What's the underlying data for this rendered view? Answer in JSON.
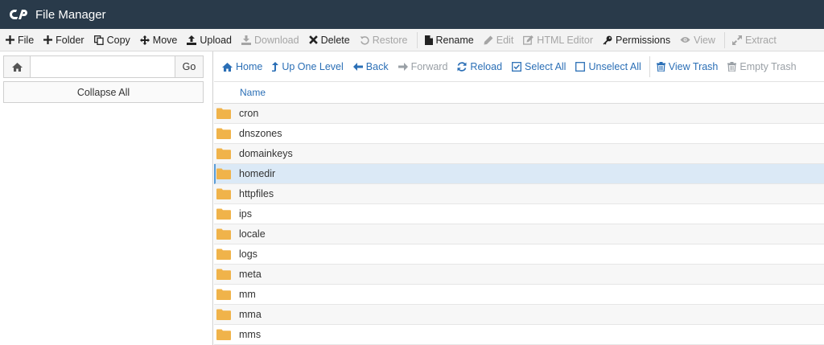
{
  "app": {
    "title": "File Manager"
  },
  "toolbar": [
    {
      "label": "File",
      "icon": "plus-icon",
      "disabled": false
    },
    {
      "label": "Folder",
      "icon": "plus-icon",
      "disabled": false
    },
    {
      "label": "Copy",
      "icon": "copy-icon",
      "disabled": false
    },
    {
      "label": "Move",
      "icon": "move-icon",
      "disabled": false
    },
    {
      "label": "Upload",
      "icon": "upload-icon",
      "disabled": false
    },
    {
      "label": "Download",
      "icon": "download-icon",
      "disabled": true
    },
    {
      "label": "Delete",
      "icon": "delete-icon",
      "disabled": false
    },
    {
      "label": "Restore",
      "icon": "restore-icon",
      "disabled": true
    },
    {
      "label": "Rename",
      "icon": "rename-icon",
      "disabled": false
    },
    {
      "label": "Edit",
      "icon": "pencil-icon",
      "disabled": true
    },
    {
      "label": "HTML Editor",
      "icon": "html-editor-icon",
      "disabled": true
    },
    {
      "label": "Permissions",
      "icon": "key-icon",
      "disabled": false
    },
    {
      "label": "View",
      "icon": "eye-icon",
      "disabled": true
    },
    {
      "label": "Extract",
      "icon": "extract-icon",
      "disabled": true
    }
  ],
  "leftpanel": {
    "path_value": "",
    "go_label": "Go",
    "collapse_label": "Collapse All"
  },
  "navbar": [
    {
      "label": "Home",
      "icon": "home-icon",
      "disabled": false
    },
    {
      "label": "Up One Level",
      "icon": "up-level-icon",
      "disabled": false
    },
    {
      "label": "Back",
      "icon": "back-arrow-icon",
      "disabled": false
    },
    {
      "label": "Forward",
      "icon": "forward-arrow-icon",
      "disabled": true
    },
    {
      "label": "Reload",
      "icon": "reload-icon",
      "disabled": false
    },
    {
      "label": "Select All",
      "icon": "checked-box-icon",
      "disabled": false
    },
    {
      "label": "Unselect All",
      "icon": "empty-box-icon",
      "disabled": false
    },
    {
      "label": "View Trash",
      "icon": "trash-icon",
      "disabled": false
    },
    {
      "label": "Empty Trash",
      "icon": "trash-icon",
      "disabled": true
    }
  ],
  "table": {
    "header_name": "Name",
    "selected_row": "homedir",
    "rows": [
      "cron",
      "dnszones",
      "domainkeys",
      "homedir",
      "httpfiles",
      "ips",
      "locale",
      "logs",
      "meta",
      "mm",
      "mma",
      "mms"
    ]
  },
  "colors": {
    "titlebar": "#293a4a",
    "link": "#2b6fb6",
    "folder": "#f0b34a",
    "selected_row": "#dbe9f6"
  }
}
